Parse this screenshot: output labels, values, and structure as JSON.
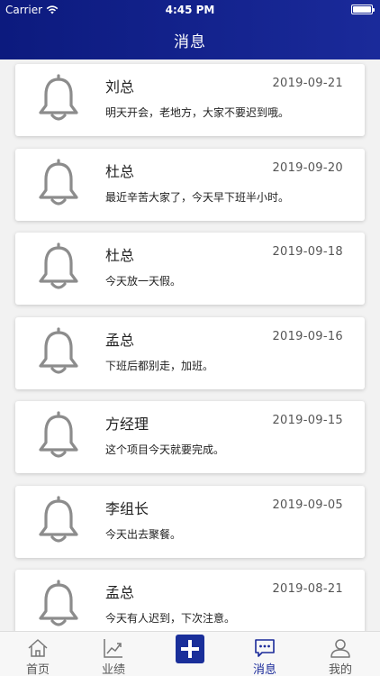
{
  "status": {
    "carrier": "Carrier",
    "time": "4:45 PM"
  },
  "header": {
    "title": "消息"
  },
  "messages": [
    {
      "sender": "刘总",
      "date": "2019-09-21",
      "text": "明天开会，老地方，大家不要迟到哦。"
    },
    {
      "sender": "杜总",
      "date": "2019-09-20",
      "text": "最近辛苦大家了，今天早下班半小时。"
    },
    {
      "sender": "杜总",
      "date": "2019-09-18",
      "text": "今天放一天假。"
    },
    {
      "sender": "孟总",
      "date": "2019-09-16",
      "text": "下班后都别走，加班。"
    },
    {
      "sender": "方经理",
      "date": "2019-09-15",
      "text": "这个项目今天就要完成。"
    },
    {
      "sender": "李组长",
      "date": "2019-09-05",
      "text": "今天出去聚餐。"
    },
    {
      "sender": "孟总",
      "date": "2019-08-21",
      "text": "今天有人迟到，下次注意。"
    }
  ],
  "tabs": [
    {
      "label": "首页",
      "icon": "home-icon"
    },
    {
      "label": "业绩",
      "icon": "chart-icon"
    },
    {
      "label": "",
      "icon": "plus-icon"
    },
    {
      "label": "消息",
      "icon": "message-icon",
      "active": true
    },
    {
      "label": "我的",
      "icon": "user-icon"
    }
  ],
  "colors": {
    "primary": "#1a2a9a",
    "icon_gray": "#8c8c8c"
  }
}
